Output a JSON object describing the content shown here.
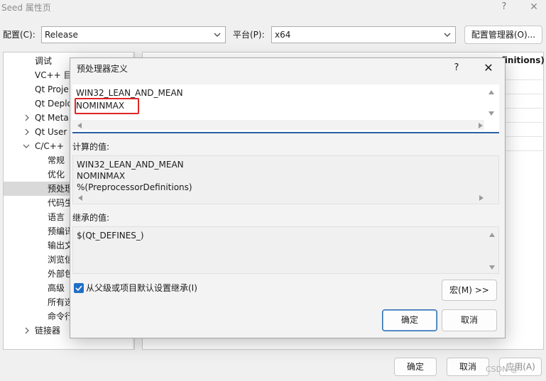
{
  "main": {
    "title": "Seed 属性页",
    "help": "?",
    "close": "✕",
    "config_label": "配置(C):",
    "config_value": "Release",
    "platform_label": "平台(P):",
    "platform_value": "x64",
    "config_manager": "配置管理器(O)...",
    "right_header": "finitions)",
    "ok": "确定",
    "cancel": "取消",
    "apply": "应用(A)",
    "watermark": "CSDN @ · ·"
  },
  "tree": {
    "items": [
      {
        "label": "调试"
      },
      {
        "label": "VC++ 目"
      },
      {
        "label": "Qt Proje"
      },
      {
        "label": "Qt Deplo"
      },
      {
        "label": "Qt Meta"
      },
      {
        "label": "Qt User"
      },
      {
        "label": "C/C++"
      },
      {
        "label": "常规"
      },
      {
        "label": "优化"
      },
      {
        "label": "预处理"
      },
      {
        "label": "代码生"
      },
      {
        "label": "语言"
      },
      {
        "label": "预编译"
      },
      {
        "label": "输出文"
      },
      {
        "label": "浏览信"
      },
      {
        "label": "外部包"
      },
      {
        "label": "高级"
      },
      {
        "label": "所有选"
      },
      {
        "label": "命令行"
      },
      {
        "label": "链接器"
      }
    ]
  },
  "dialog": {
    "title": "预处理器定义",
    "help": "?",
    "close": "✕",
    "edit_line1": "WIN32_LEAN_AND_MEAN",
    "edit_line2": "NOMINMAX",
    "computed_label": "计算的值:",
    "computed_line1": "WIN32_LEAN_AND_MEAN",
    "computed_line2": "NOMINMAX",
    "computed_line3": "%(PreprocessorDefinitions)",
    "inherited_label": "继承的值:",
    "inherited_line1": "$(Qt_DEFINES_)",
    "inherit_checkbox": "从父级或项目默认设置继承(I)",
    "macro_button": "宏(M) >>",
    "ok": "确定",
    "cancel": "取消"
  },
  "colors": {
    "accent": "#1f6fc5",
    "highlight": "#e02424"
  }
}
